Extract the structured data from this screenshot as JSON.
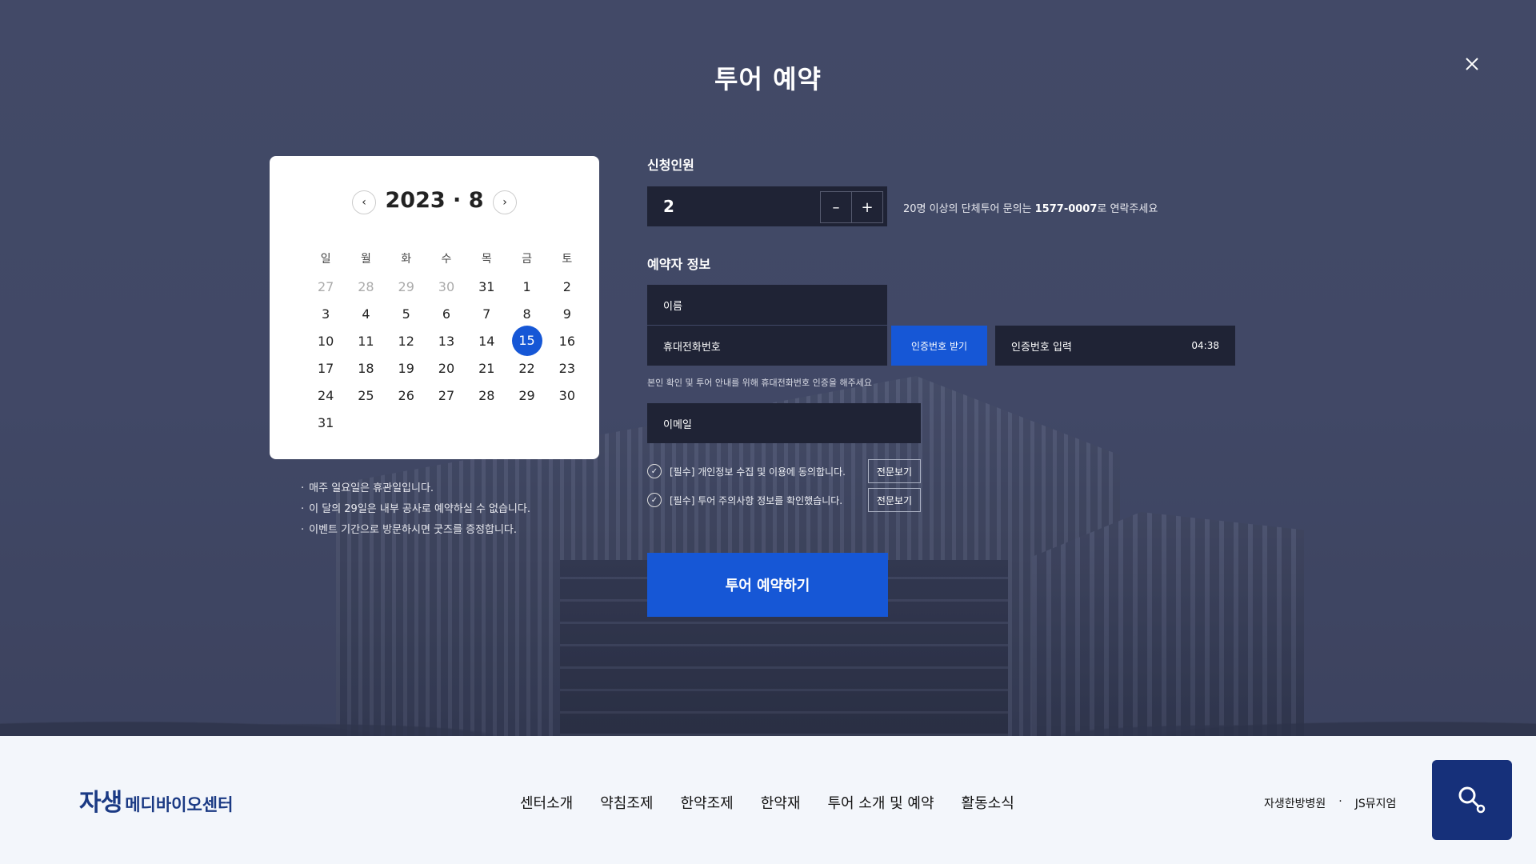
{
  "modal": {
    "title": "투어 예약",
    "close_icon": "close-icon"
  },
  "calendar": {
    "title": "2023 · 8",
    "weekdays": [
      "일",
      "월",
      "화",
      "수",
      "목",
      "금",
      "토"
    ],
    "weeks": [
      [
        "27",
        "28",
        "29",
        "30",
        "31",
        "1",
        "2"
      ],
      [
        "3",
        "4",
        "5",
        "6",
        "7",
        "8",
        "9"
      ],
      [
        "10",
        "11",
        "12",
        "13",
        "14",
        "15",
        "16"
      ],
      [
        "17",
        "18",
        "19",
        "20",
        "21",
        "22",
        "23"
      ],
      [
        "24",
        "25",
        "26",
        "27",
        "28",
        "29",
        "30"
      ],
      [
        "31",
        "",
        "",
        "",
        "",
        "",
        ""
      ]
    ],
    "muted_days": [
      "27",
      "28",
      "29",
      "30"
    ],
    "selected_day": "15",
    "notes": [
      "매주 일요일은 휴관일입니다.",
      "이 달의 29일은 내부 공사로 예약하실 수 없습니다.",
      "이벤트 기간으로 방문하시면 굿즈를 증정합니다."
    ]
  },
  "form": {
    "people_label": "신청인원",
    "people_value": "2",
    "minus": "–",
    "plus": "+",
    "group_note_prefix": "20명 이상의 단체투어 문의는 ",
    "group_phone": "1577-0007",
    "group_note_suffix": "로 연락주세요",
    "booker_label": "예약자 정보",
    "name_placeholder": "이름",
    "phone_placeholder": "휴대전화번호",
    "auth_button": "인증번호 받기",
    "auth_placeholder": "인증번호 입력",
    "auth_timer": "04:38",
    "phone_note": "본인 확인 및 투어 안내를 위해 휴대전화번호 인증을 해주세요",
    "email_placeholder": "이메일",
    "agree1": "[필수] 개인정보 수집 및 이용에 동의합니다.",
    "agree2": "[필수] 투어 주의사항 정보를 확인했습니다.",
    "view_full": "전문보기",
    "submit": "투어 예약하기"
  },
  "footer": {
    "logo_main": "자생",
    "logo_sub": "메디바이오센터",
    "menu": [
      "센터소개",
      "약침조제",
      "한약조제",
      "한약재",
      "투어 소개 및 예약",
      "활동소식"
    ],
    "family": [
      "자생한방병원",
      "JS뮤지엄"
    ],
    "family_sep": "·",
    "search_icon": "search-icon",
    "accent": "#16307a"
  },
  "colors": {
    "primary": "#1657d6",
    "field_bg": "#1f2335"
  }
}
